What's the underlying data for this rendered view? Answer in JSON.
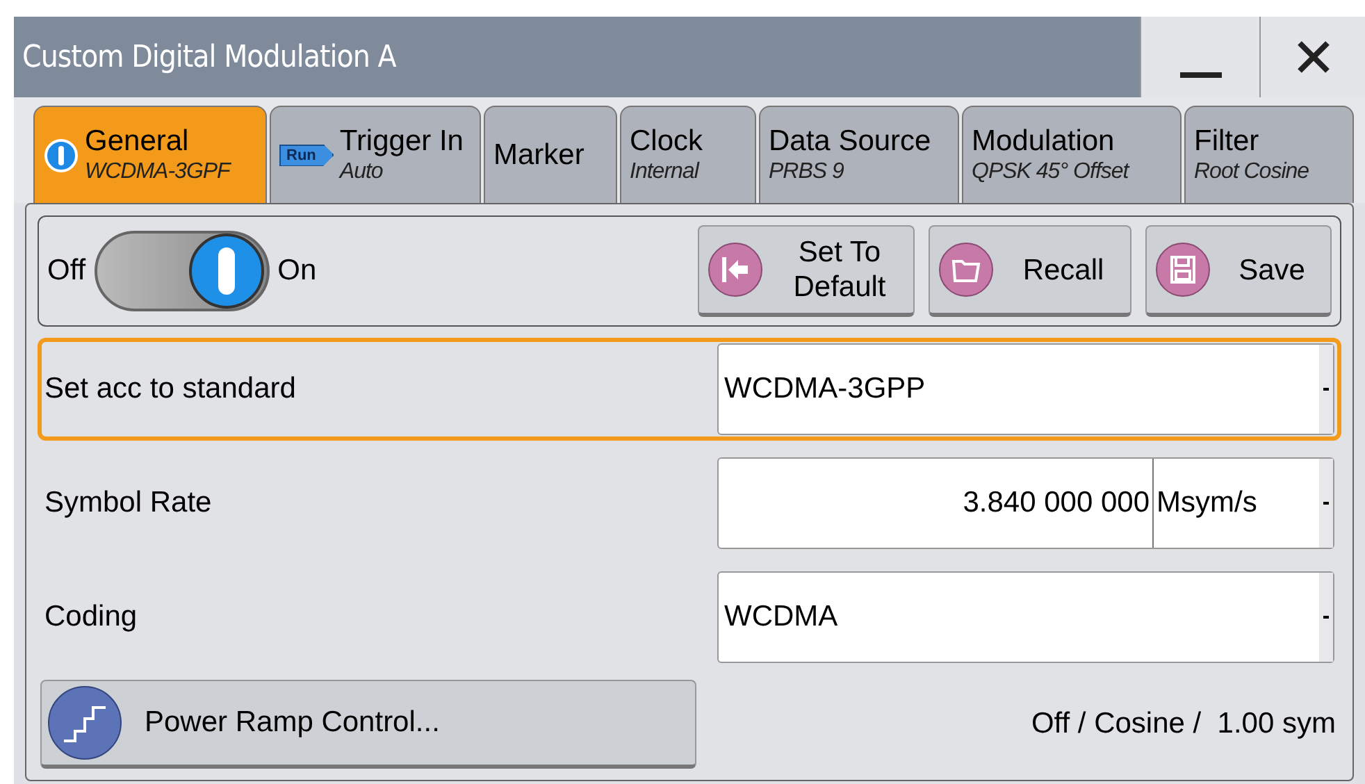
{
  "window": {
    "title": "Custom Digital Modulation A"
  },
  "tabs": [
    {
      "label": "General",
      "sub": "WCDMA-3GPF",
      "selected": true
    },
    {
      "label": "Trigger In",
      "sub": "Auto",
      "run_text": "Run",
      "selected": false
    },
    {
      "label": "Marker",
      "selected": false
    },
    {
      "label": "Clock",
      "sub": "Internal",
      "selected": false
    },
    {
      "label": "Data Source",
      "sub": "PRBS 9",
      "selected": false
    },
    {
      "label": "Modulation",
      "sub": "QPSK 45° Offset",
      "selected": false
    },
    {
      "label": "Filter",
      "sub": "Root Cosine",
      "selected": false
    }
  ],
  "state": {
    "off_label": "Off",
    "on_label": "On",
    "on": true
  },
  "actions": [
    {
      "label": "Set To Default"
    },
    {
      "label": "Recall"
    },
    {
      "label": "Save"
    }
  ],
  "rows": [
    {
      "label": "Set acc to standard",
      "value": "WCDMA-3GPP",
      "focused": true
    },
    {
      "label": "Symbol Rate",
      "value": "3.840 000 000",
      "unit": "Msym/s",
      "focused": false
    },
    {
      "label": "Coding",
      "value": "WCDMA",
      "focused": false
    }
  ],
  "power_ramp": {
    "button": "Power Ramp Control...",
    "summary": "Off / Cosine /  1.00 sym"
  }
}
